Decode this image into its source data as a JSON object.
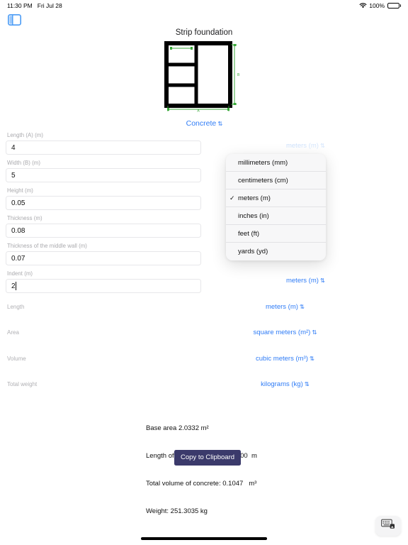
{
  "status_bar": {
    "time": "11:30 PM",
    "date": "Fri Jul 28",
    "wifi_icon": "wifi-icon",
    "battery_percent": "100%",
    "battery_icon": "battery-full-icon"
  },
  "navigation": {
    "sidebar_toggle_icon": "sidebar-toggle-icon"
  },
  "header": {
    "title": "Strip foundation"
  },
  "diagram": {
    "name": "strip-foundation-plan",
    "dimension_labels": {
      "width": "A",
      "height": "B"
    },
    "wall_color": "#000000",
    "dimension_color": "#3ba93b"
  },
  "material_picker": {
    "label": "Concrete",
    "chevron": "⌃⌄"
  },
  "form": {
    "fields": [
      {
        "label": "Length (A) (m)",
        "value": "4",
        "unit": "meters (m)",
        "name": "length-a"
      },
      {
        "label": "Width (B) (m)",
        "value": "5",
        "unit": "",
        "name": "width-b"
      },
      {
        "label": "Height (m)",
        "value": "0.05",
        "unit": "",
        "name": "height"
      },
      {
        "label": "Thickness (m)",
        "value": "0.08",
        "unit": "",
        "name": "thickness"
      },
      {
        "label": "Thickness of the middle wall (m)",
        "value": "0.07",
        "unit": "",
        "name": "middle-wall-thickness"
      },
      {
        "label": "Indent (m)",
        "value": "2",
        "unit": "meters (m)",
        "name": "indent"
      }
    ]
  },
  "unit_selectors": {
    "top": "meters (m)",
    "indent": "meters (m)"
  },
  "dropdown": {
    "open": true,
    "selected": "meters (m)",
    "check_glyph": "✓",
    "options": [
      "millimeters (mm)",
      "centimeters (cm)",
      "meters (m)",
      "inches (in)",
      "feet (ft)",
      "yards (yd)"
    ]
  },
  "results_rows": [
    {
      "label": "Length",
      "unit": "meters (m)",
      "name": "length"
    },
    {
      "label": "Area",
      "unit": "square meters (m²)",
      "name": "area"
    },
    {
      "label": "Volume",
      "unit": "cubic meters (m³)",
      "name": "volume"
    },
    {
      "label": "Total weight",
      "unit": "kilograms (kg)",
      "name": "total-weight"
    }
  ],
  "results_text": {
    "line1": "Base area 2.0332 m²",
    "line2": "Length of the whole tape: 26.8400  m",
    "line3": "Total volume of concrete: 0.1047   m³",
    "line4": "Weight: 251.3035 kg"
  },
  "copy_button": {
    "label": "Copy to Clipboard",
    "background": "#3b3a6b"
  },
  "keyboard_fab": {
    "icon": "keyboard-dismiss-icon"
  },
  "colors": {
    "accent_blue": "#2f7cf6",
    "label_gray": "#a9a9ad",
    "border_gray": "#e7e7ea"
  }
}
